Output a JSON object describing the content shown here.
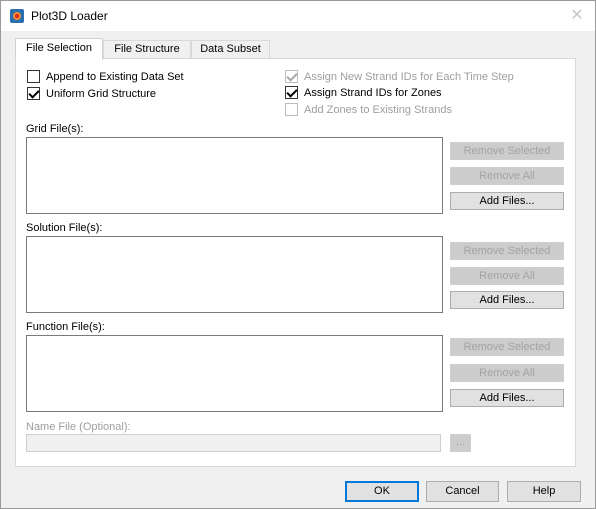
{
  "window": {
    "title": "Plot3D Loader",
    "close_glyph": "✕"
  },
  "tabs": [
    {
      "label": "File Selection",
      "active": true
    },
    {
      "label": "File Structure",
      "active": false
    },
    {
      "label": "Data Subset",
      "active": false
    }
  ],
  "options": {
    "append": {
      "label": "Append to Existing Data Set",
      "checked": false,
      "enabled": true
    },
    "uniform": {
      "label": "Uniform Grid Structure",
      "checked": true,
      "enabled": true
    },
    "assign_new_strand": {
      "label": "Assign New Strand IDs for Each Time Step",
      "checked": true,
      "enabled": false
    },
    "assign_strand_zones": {
      "label": "Assign Strand IDs for Zones",
      "checked": true,
      "enabled": true
    },
    "add_zones": {
      "label": "Add Zones to Existing Strands",
      "checked": false,
      "enabled": false
    }
  },
  "groups": {
    "grid": {
      "label": "Grid File(s):",
      "remove_selected": "Remove Selected",
      "remove_all": "Remove All",
      "add_files": "Add Files..."
    },
    "solution": {
      "label": "Solution File(s):",
      "remove_selected": "Remove Selected",
      "remove_all": "Remove All",
      "add_files": "Add Files..."
    },
    "function": {
      "label": "Function File(s):",
      "remove_selected": "Remove Selected",
      "remove_all": "Remove All",
      "add_files": "Add Files..."
    }
  },
  "name_file": {
    "label": "Name File (Optional):",
    "value": "",
    "browse_label": "..."
  },
  "footer": {
    "ok": "OK",
    "cancel": "Cancel",
    "help": "Help"
  },
  "colors": {
    "dialog_bg": "#f0f0f0",
    "default_button_border": "#0078d7",
    "disabled_text": "#9e9e9e"
  },
  "icons": {
    "app": "plot3d-app-icon",
    "close": "close-icon",
    "checkmark": "checkmark-icon"
  }
}
